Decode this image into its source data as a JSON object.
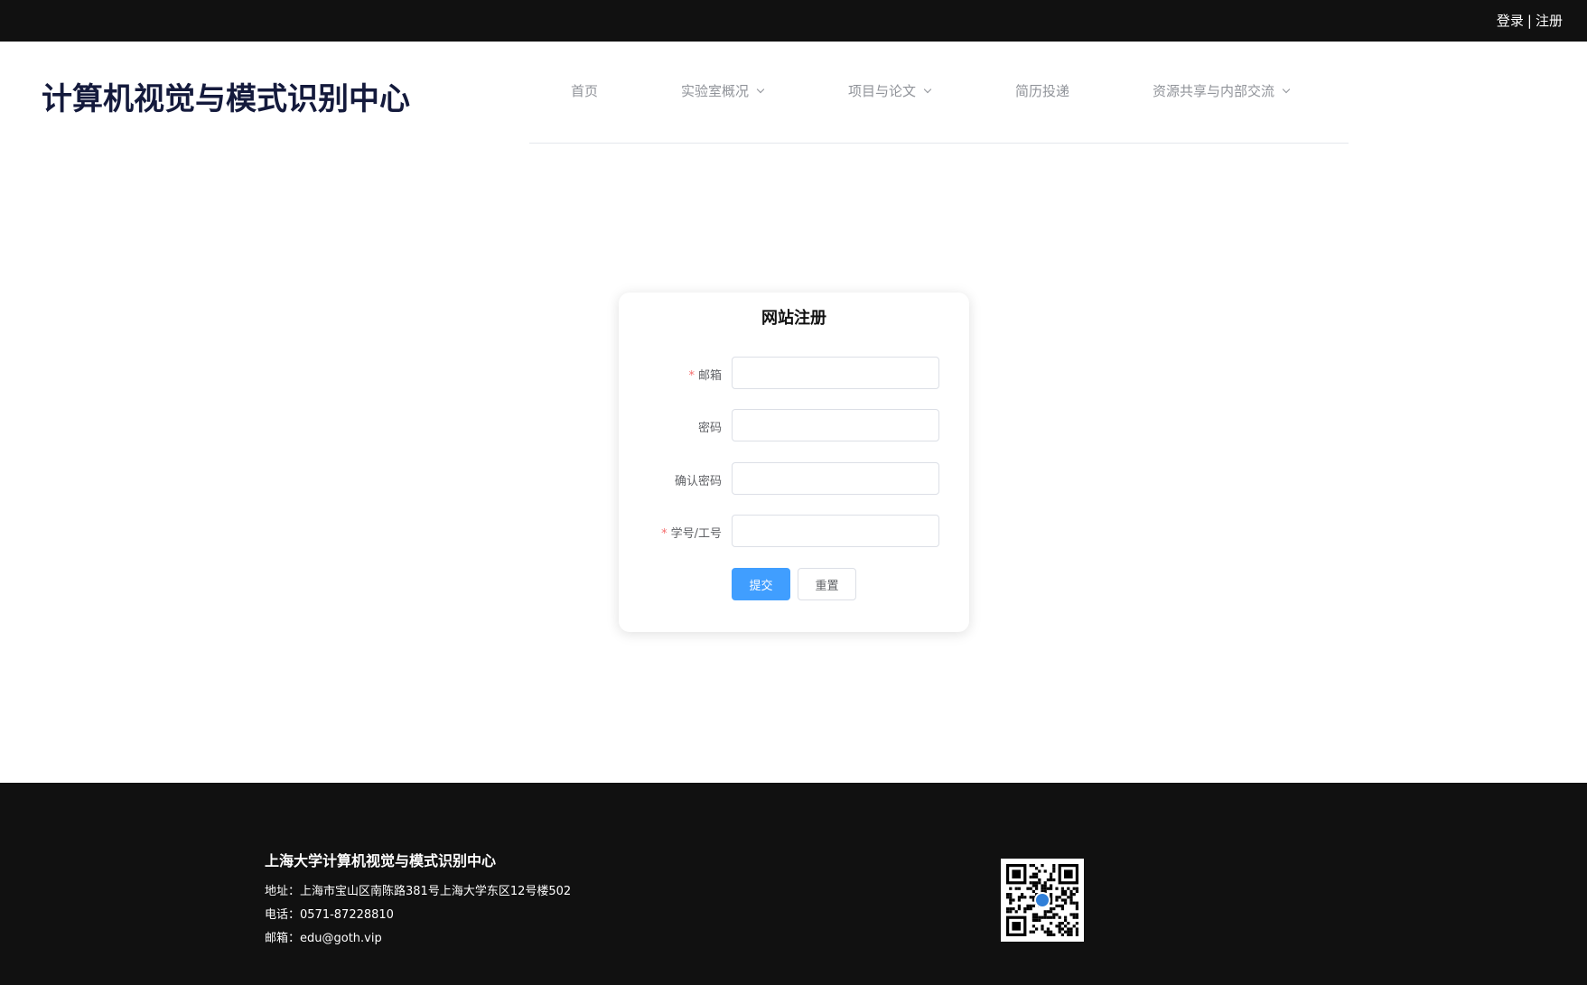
{
  "topbar": {
    "login_label": "登录",
    "separator": "|",
    "register_label": "注册"
  },
  "header": {
    "site_title": "计算机视觉与模式识别中心",
    "nav": [
      {
        "label": "首页",
        "has_dropdown": false
      },
      {
        "label": "实验室概况",
        "has_dropdown": true
      },
      {
        "label": "项目与论文",
        "has_dropdown": true
      },
      {
        "label": "简历投递",
        "has_dropdown": false
      },
      {
        "label": "资源共享与内部交流",
        "has_dropdown": true
      }
    ]
  },
  "register_form": {
    "title": "网站注册",
    "fields": [
      {
        "label": "邮箱",
        "required": true,
        "value": ""
      },
      {
        "label": "密码",
        "required": false,
        "value": ""
      },
      {
        "label": "确认密码",
        "required": false,
        "value": ""
      },
      {
        "label": "学号/工号",
        "required": true,
        "value": ""
      }
    ],
    "submit_label": "提交",
    "reset_label": "重置",
    "required_marker": "*"
  },
  "footer": {
    "org_name": "上海大学计算机视觉与模式识别中心",
    "address": "地址：上海市宝山区南陈路381号上海大学东区12号楼502",
    "phone": "电话：0571-87228810",
    "email": "邮箱：edu@goth.vip",
    "qr_icon": "qr-code-icon"
  },
  "colors": {
    "topbar_bg": "#111111",
    "footer_bg": "#111111",
    "title_color": "#141a3c",
    "primary": "#409eff",
    "required": "#f56c6c"
  }
}
